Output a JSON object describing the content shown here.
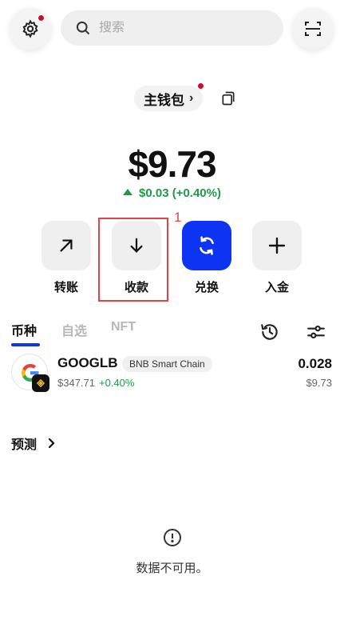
{
  "header": {
    "search_placeholder": "搜索",
    "settings_icon": "gear-icon",
    "scan_icon": "scan-icon"
  },
  "wallet": {
    "name": "主钱包",
    "balance": "$9.73",
    "change": "$0.03 (+0.40%)"
  },
  "actions": [
    {
      "label": "转账",
      "icon": "arrow-up-right-icon"
    },
    {
      "label": "收款",
      "icon": "arrow-down-icon"
    },
    {
      "label": "兑换",
      "icon": "swap-icon"
    },
    {
      "label": "入金",
      "icon": "plus-icon"
    }
  ],
  "annotation": {
    "number": "1"
  },
  "tabs": [
    {
      "label": "币种",
      "active": true
    },
    {
      "label": "自选",
      "active": false
    },
    {
      "label": "NFT",
      "active": false
    }
  ],
  "tokens": [
    {
      "symbol": "GOOGLB",
      "chain": "BNB Smart Chain",
      "price": "$347.71",
      "pct": "+0.40%",
      "amount": "0.028",
      "value": "$9.73"
    }
  ],
  "prediction": {
    "label": "预测"
  },
  "empty_state": {
    "message": "数据不可用。"
  },
  "colors": {
    "accent": "#0d34f2",
    "positive": "#1e9a48",
    "notify": "#c8102e",
    "annotation": "#e0444a"
  }
}
